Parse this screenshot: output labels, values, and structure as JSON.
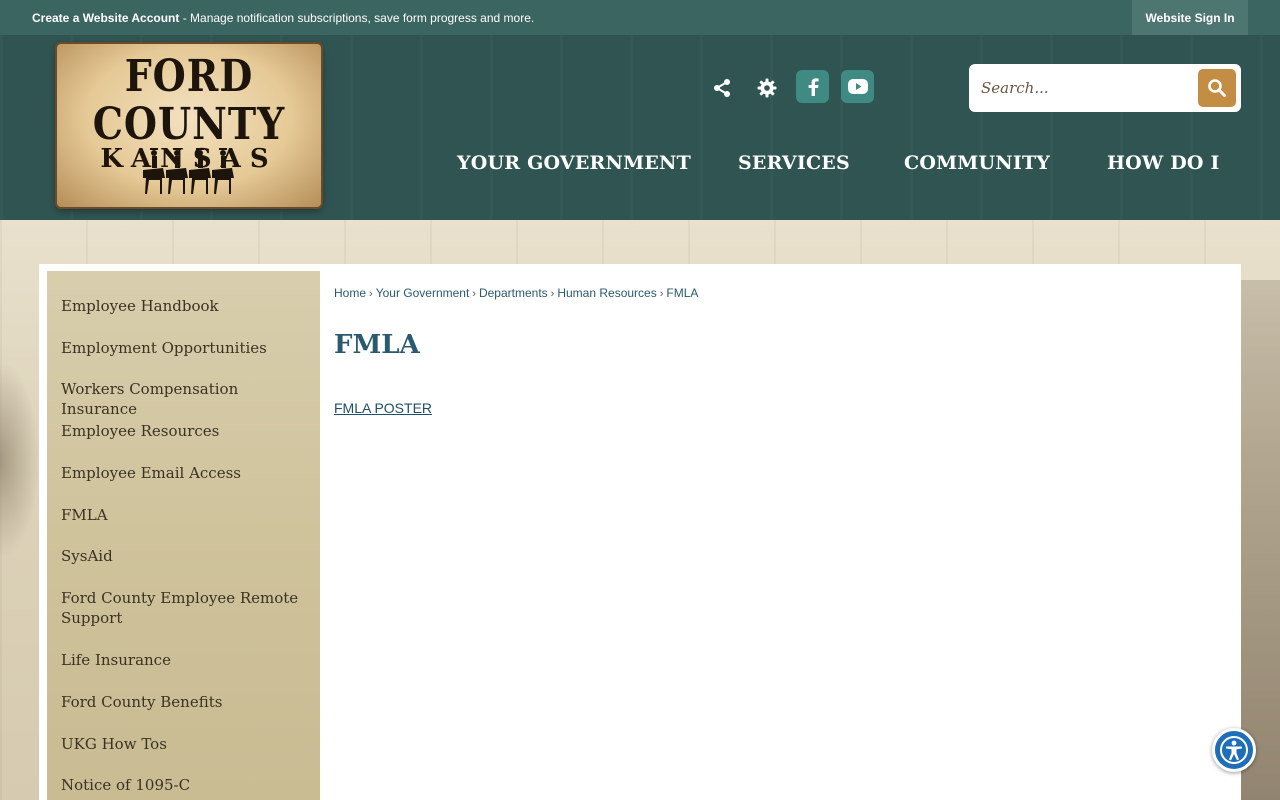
{
  "topbar": {
    "account_bold": "Create a Website Account",
    "account_rest": " - Manage notification subscriptions, save form progress and more.",
    "signin": "Website Sign In"
  },
  "logo": {
    "line1": "FORD COUNTY",
    "line2": "KANSAS"
  },
  "header_icons": [
    "share-icon",
    "gear-icon",
    "facebook-icon",
    "youtube-icon"
  ],
  "search": {
    "placeholder": "Search..."
  },
  "nav": [
    {
      "label": "YOUR GOVERNMENT"
    },
    {
      "label": "SERVICES"
    },
    {
      "label": "COMMUNITY"
    },
    {
      "label": "HOW DO I"
    }
  ],
  "sidebar": {
    "items": [
      {
        "label": "Employee Handbook"
      },
      {
        "label": "Employment Opportunities"
      },
      {
        "label": "Workers Compensation Insurance"
      },
      {
        "label": "Employee Resources"
      },
      {
        "label": "Employee Email Access"
      },
      {
        "label": "FMLA"
      },
      {
        "label": "SysAid"
      },
      {
        "label": "Ford County Employee Remote Support"
      },
      {
        "label": "Life Insurance"
      },
      {
        "label": "Ford County Benefits"
      },
      {
        "label": "UKG How Tos"
      },
      {
        "label": "Notice of 1095-C"
      }
    ]
  },
  "breadcrumb": [
    "Home",
    "Your Government",
    "Departments",
    "Human Resources",
    "FMLA"
  ],
  "main": {
    "title": "FMLA",
    "link": "FMLA POSTER"
  },
  "colors": {
    "topbar": "#3b6561",
    "header": "#2f5451",
    "accent_gold": "#c38e43",
    "link_blue": "#2b5a6f"
  }
}
